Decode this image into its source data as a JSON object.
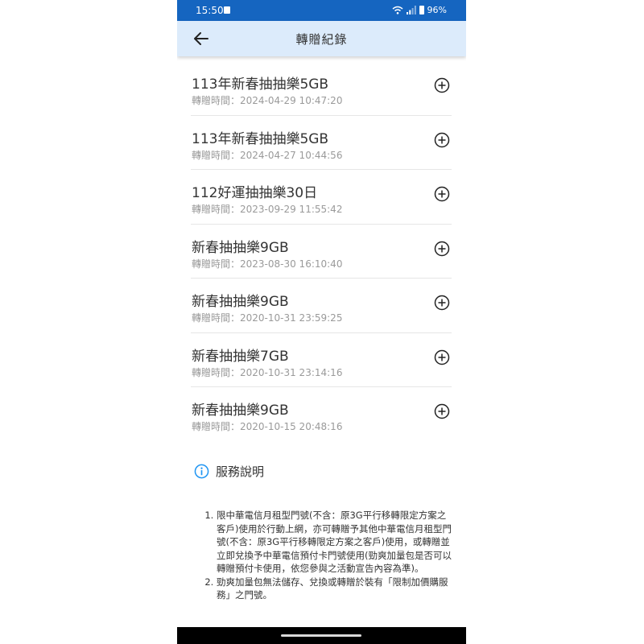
{
  "status_bar": {
    "time": "15:50",
    "battery": "96%"
  },
  "app_bar": {
    "title": "轉贈紀錄"
  },
  "records": [
    {
      "name": "113年新春抽抽樂5GB",
      "meta": "轉贈時間：2024-04-29 10:47:20"
    },
    {
      "name": "113年新春抽抽樂5GB",
      "meta": "轉贈時間：2024-04-27 10:44:56"
    },
    {
      "name": "112好運抽抽樂30日",
      "meta": "轉贈時間：2023-09-29 11:55:42"
    },
    {
      "name": "新春抽抽樂9GB",
      "meta": "轉贈時間：2023-08-30 16:10:40"
    },
    {
      "name": "新春抽抽樂9GB",
      "meta": "轉贈時間：2020-10-31 23:59:25"
    },
    {
      "name": "新春抽抽樂7GB",
      "meta": "轉贈時間：2020-10-31 23:14:16"
    },
    {
      "name": "新春抽抽樂9GB",
      "meta": "轉贈時間：2020-10-15 20:48:16"
    }
  ],
  "service": {
    "title": "服務說明",
    "items": [
      "限中華電信月租型門號(不含：原3G平行移轉限定方案之客戶)使用於行動上網，亦可轉贈予其他中華電信月租型門號(不含：原3G平行移轉限定方案之客戶)使用，或轉贈並立即兌換予中華電信預付卡門號使用(勁爽加量包是否可以轉贈預付卡使用，依您參與之活動宣告內容為準)。",
      "勁爽加量包無法儲存、兌換或轉贈於裝有「限制加價購服務」之門號。"
    ]
  },
  "colors": {
    "status_bar": "#1565c0",
    "app_bar": "#dcebfb",
    "info_icon": "#2196f3"
  }
}
